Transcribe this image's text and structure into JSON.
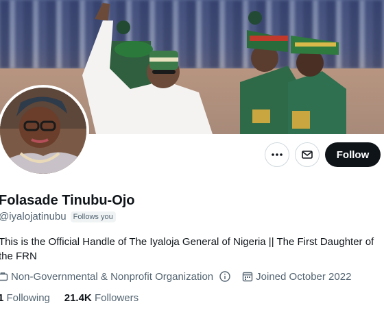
{
  "profile": {
    "display_name": "Folasade Tinubu-Ojo",
    "handle": "@iyalojatinubu",
    "follows_you_badge": "Follows you",
    "bio": "This is the Official Handle of The Iyaloja General of Nigeria || The First Daughter of the FRN",
    "category": "Non-Governmental & Nonprofit Organization",
    "joined": "Joined October 2022"
  },
  "stats": {
    "following_count": "1",
    "following_label": "Following",
    "followers_count": "21.4K",
    "followers_label": "Followers"
  },
  "actions": {
    "follow_label": "Follow"
  },
  "icons": {
    "more": "more-icon",
    "message": "mail-icon",
    "category": "briefcase-icon",
    "info": "info-icon",
    "calendar": "calendar-icon"
  },
  "colors": {
    "follow_button_bg": "#0f1419",
    "secondary_text": "#536471",
    "badge_bg": "#eff3f4"
  }
}
